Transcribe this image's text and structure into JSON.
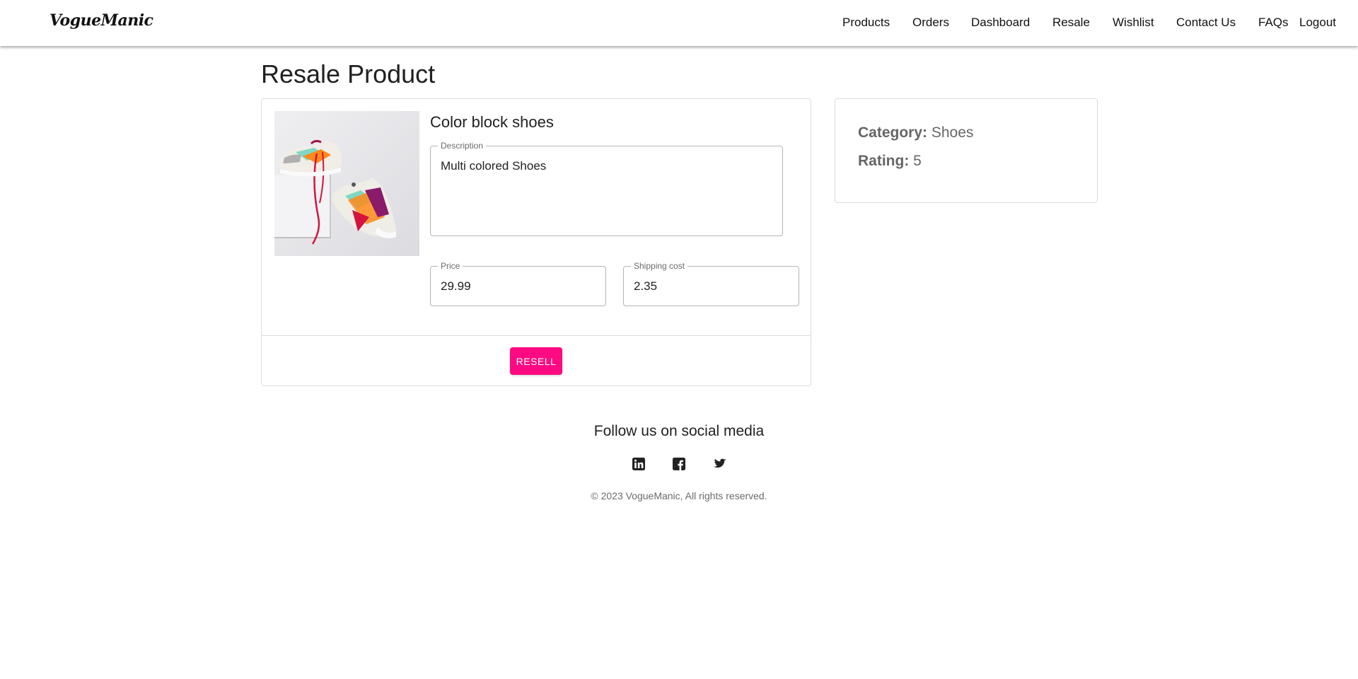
{
  "header": {
    "brand": "VogueManic",
    "nav": [
      {
        "label": "Products"
      },
      {
        "label": "Orders"
      },
      {
        "label": "Dashboard"
      },
      {
        "label": "Resale"
      },
      {
        "label": "Wishlist"
      },
      {
        "label": "Contact Us"
      },
      {
        "label": "FAQs"
      },
      {
        "label": "Logout"
      }
    ]
  },
  "page": {
    "title": "Resale Product"
  },
  "product": {
    "name": "Color block shoes",
    "image_icon": "sneakers-photo",
    "description_label": "Description",
    "description_value": "Multi colored Shoes",
    "price_label": "Price",
    "price_value": "29.99",
    "shipping_label": "Shipping cost",
    "shipping_value": "2.35",
    "resell_label": "RESELL"
  },
  "info": {
    "category_key": "Category:",
    "category_value": "Shoes",
    "rating_key": "Rating:",
    "rating_value": "5"
  },
  "footer": {
    "heading": "Follow us on social media",
    "social": [
      {
        "icon": "linkedin-icon"
      },
      {
        "icon": "facebook-icon"
      },
      {
        "icon": "twitter-icon"
      }
    ],
    "copyright": "© 2023 VogueManic, All rights reserved."
  },
  "colors": {
    "accent": "#ff0a82",
    "text": "#212121",
    "muted": "#666666",
    "border": "#dcdcdc"
  }
}
